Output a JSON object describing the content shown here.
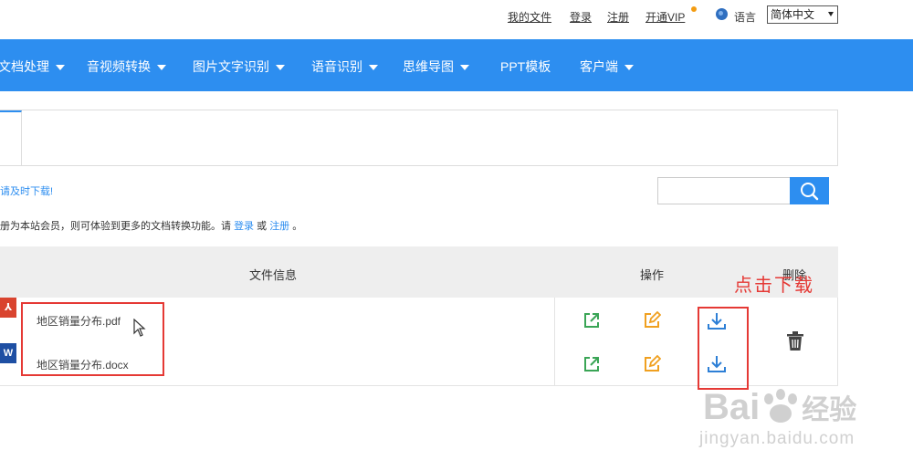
{
  "top_links": {
    "my_files": "我的文件",
    "login": "登录",
    "register": "注册",
    "vip": "开通VIP"
  },
  "language": {
    "label": "语言",
    "selected": "简体中文"
  },
  "nav": {
    "items": [
      {
        "label": "文档处理"
      },
      {
        "label": "音视频转换"
      },
      {
        "label": "图片文字识别"
      },
      {
        "label": "语音识别"
      },
      {
        "label": "思维导图"
      },
      {
        "label": "PPT模板"
      },
      {
        "label": "客户端"
      }
    ]
  },
  "notice": "请及时下载!",
  "member": {
    "text": "册为本站会员，则可体验到更多的文档转换功能。请",
    "login": "登录",
    "or": "或",
    "register": "注册",
    "end": "。"
  },
  "table": {
    "headers": {
      "file_info": "文件信息",
      "actions": "操作",
      "delete": "删除"
    },
    "rows": [
      {
        "filename": "地区销量分布.pdf",
        "type_badge": "⅄"
      },
      {
        "filename": "地区销量分布.docx",
        "type_badge": "W"
      }
    ]
  },
  "annotation": "点击下载",
  "watermark": {
    "logo": "Bai",
    "logo_cn": "经验",
    "url": "jingyan.baidu.com"
  },
  "colors": {
    "brand_blue": "#2d8ef0",
    "annotation_red": "#e53935",
    "open_green": "#3aa556",
    "edit_orange": "#f0a020",
    "download_blue": "#2d7fd6"
  },
  "icons": {
    "search": "search-icon",
    "open": "open-external-icon",
    "edit": "edit-icon",
    "download": "download-icon",
    "delete": "trash-icon",
    "globe": "globe-icon"
  }
}
